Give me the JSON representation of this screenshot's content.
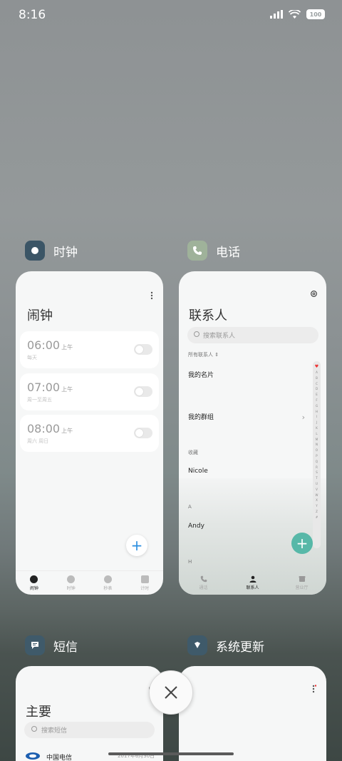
{
  "status_bar": {
    "time": "8:16",
    "battery": "100"
  },
  "apps": {
    "clock": {
      "name": "时钟",
      "title": "闹钟",
      "alarms": [
        {
          "time": "06:00",
          "ampm": "上午",
          "repeat": "每天"
        },
        {
          "time": "07:00",
          "ampm": "上午",
          "repeat": "周一至周五"
        },
        {
          "time": "08:00",
          "ampm": "上午",
          "repeat": "周六 周日"
        }
      ],
      "tabs": [
        {
          "label": "闹钟",
          "active": true
        },
        {
          "label": "时钟",
          "active": false
        },
        {
          "label": "秒表",
          "active": false
        },
        {
          "label": "计时",
          "active": false
        }
      ]
    },
    "phone": {
      "name": "电话",
      "title": "联系人",
      "search_placeholder": "搜索联系人",
      "filter_label": "所有联系人",
      "my_card": "我的名片",
      "my_groups": "我的群组",
      "favorites_header": "收藏",
      "favorite_contact": "Nicole",
      "section_a": "A",
      "contact_a": "Andy",
      "section_h": "H",
      "index_letters": [
        "A",
        "B",
        "C",
        "D",
        "E",
        "F",
        "G",
        "H",
        "I",
        "J",
        "K",
        "L",
        "M",
        "N",
        "O",
        "P",
        "Q",
        "R",
        "S",
        "T",
        "U",
        "V",
        "W",
        "X",
        "Y",
        "Z",
        "#"
      ],
      "tabs": [
        {
          "label": "通话",
          "active": false
        },
        {
          "label": "联系人",
          "active": true
        },
        {
          "label": "营业厅",
          "active": false
        }
      ]
    },
    "sms": {
      "name": "短信",
      "title": "主要",
      "search_placeholder": "搜索短信",
      "sender": "中国电信",
      "date": "2017年6月30日"
    },
    "update": {
      "name": "系统更新"
    }
  },
  "colors": {
    "clock_icon_bg": "#3b5566",
    "phone_icon_bg": "#9fb29a",
    "sms_icon_bg": "#3f5a6a",
    "update_icon_bg": "#3f5a6a",
    "fab_blue": "#2a8ee0",
    "fab_teal": "#57b8a8"
  }
}
